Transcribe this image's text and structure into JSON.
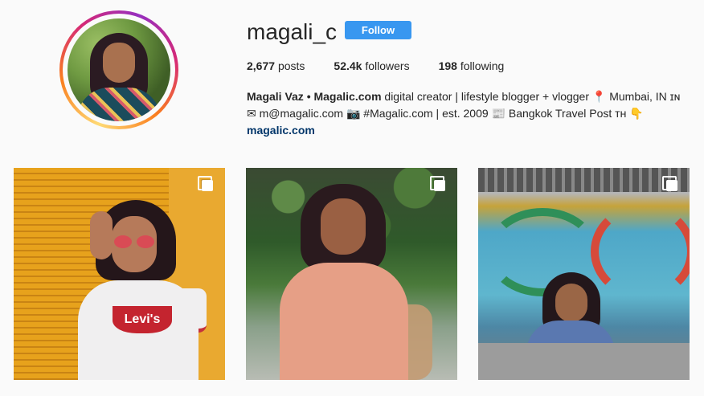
{
  "profile": {
    "username": "magali_c",
    "follow_label": "Follow",
    "stats": {
      "posts_value": "2,677",
      "posts_label": "posts",
      "followers_value": "52.4k",
      "followers_label": "followers",
      "following_value": "198",
      "following_label": "following"
    },
    "bio": {
      "name": "Magali Vaz • Magalic.com",
      "line1_rest": " digital creator | lifestyle blogger + vlogger 📍 Mumbai, IN ɪɴ",
      "line2": "✉ m@magalic.com 📷 #Magalic.com | est. 2009 📰 Bangkok Travel Post ᴛʜ 👇",
      "link": "magalic.com"
    }
  },
  "posts": [
    {
      "logo_text": "Levi's",
      "multi": "multi-photo-icon"
    },
    {
      "multi": "multi-photo-icon"
    },
    {
      "multi": "multi-photo-icon"
    }
  ],
  "colors": {
    "accent": "#3897f0",
    "link": "#003569",
    "background": "#fafafa"
  }
}
